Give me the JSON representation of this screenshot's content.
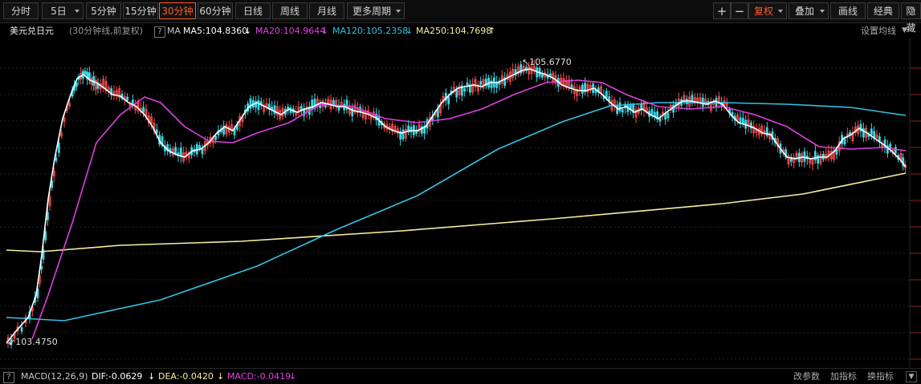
{
  "toolbar": {
    "periods": [
      {
        "label": "分时",
        "active": false
      },
      {
        "label": "5日",
        "active": false,
        "dropdown": true
      },
      {
        "label": "5分钟",
        "active": false
      },
      {
        "label": "15分钟",
        "active": false
      },
      {
        "label": "30分钟",
        "active": true
      },
      {
        "label": "60分钟",
        "active": false
      },
      {
        "label": "日线",
        "active": false
      },
      {
        "label": "周线",
        "active": false
      },
      {
        "label": "月线",
        "active": false
      },
      {
        "label": "更多周期",
        "active": false,
        "dropdown": true
      }
    ],
    "zoom_in": "+",
    "zoom_out": "−",
    "fuquan": "复权",
    "overlay": "叠加",
    "draw": "画线",
    "classic": "经典",
    "hide": "隐藏"
  },
  "info": {
    "symbol": "美元兑日元",
    "subtitle": "(30分钟线,前复权)",
    "help": "?",
    "ma_label": "MA",
    "ma5": "MA5:104.8360",
    "ma20": "MA20:104.9644",
    "ma120": "MA120:105.2358",
    "ma250": "MA250:104.7698",
    "settings": "设置均线"
  },
  "annotations": {
    "high": "105.6770",
    "low": "103.4750"
  },
  "macd": {
    "help": "?",
    "name": "MACD(12,26,9)",
    "dif": "DIF:-0.0629",
    "dea": "DEA:-0.0420",
    "macd": "MACD:-0.0419",
    "change_params": "改参数",
    "add_indicator": "加指标",
    "switch_indicator": "换指标"
  },
  "colors": {
    "up": "#ff4c4c",
    "down": "#3ad8e6",
    "ma5": "#ffffff",
    "ma20": "#e040e0",
    "ma120": "#33c3e8",
    "ma250": "#f5f0a0",
    "accent": "#ff5a2a"
  }
}
